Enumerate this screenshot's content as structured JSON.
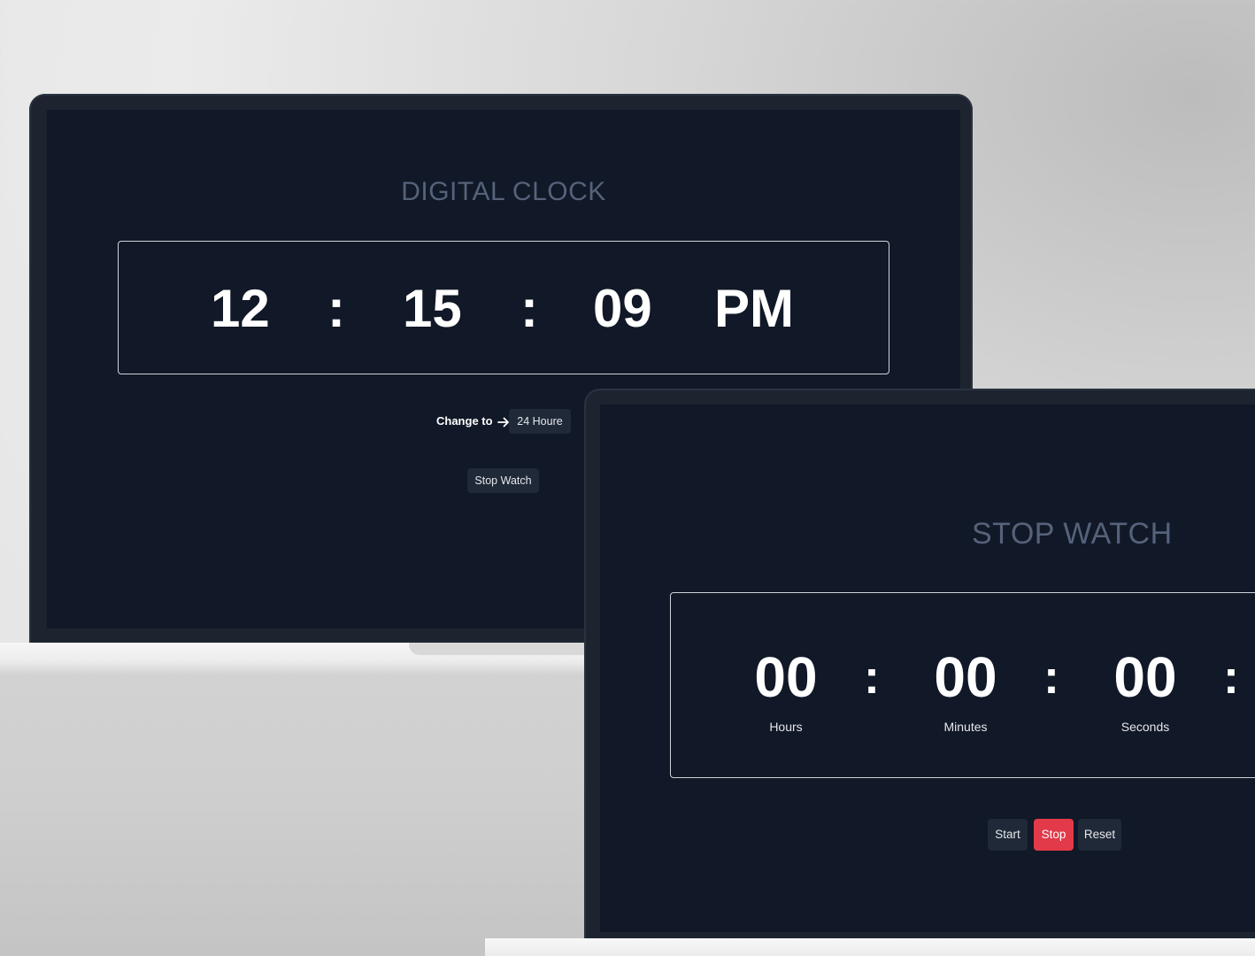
{
  "digital_clock": {
    "title": "DIGITAL CLOCK",
    "hours": "12",
    "minutes": "15",
    "seconds": "09",
    "separator": ":",
    "period": "PM",
    "change_label": "Change to",
    "format_button": "24 Houre",
    "stopwatch_button": "Stop Watch"
  },
  "stopwatch": {
    "title": "STOP WATCH",
    "hours": "00",
    "minutes": "00",
    "seconds": "00",
    "separator": ":",
    "hours_label": "Hours",
    "minutes_label": "Minutes",
    "seconds_label": "Seconds",
    "buttons": {
      "start": "Start",
      "stop": "Stop",
      "reset": "Reset"
    }
  },
  "colors": {
    "screen_bg": "#111827",
    "title_color": "#55627a",
    "button_bg": "#1f2937",
    "stop_accent": "#e23a48"
  },
  "icons": [
    "arrow-right-icon"
  ]
}
